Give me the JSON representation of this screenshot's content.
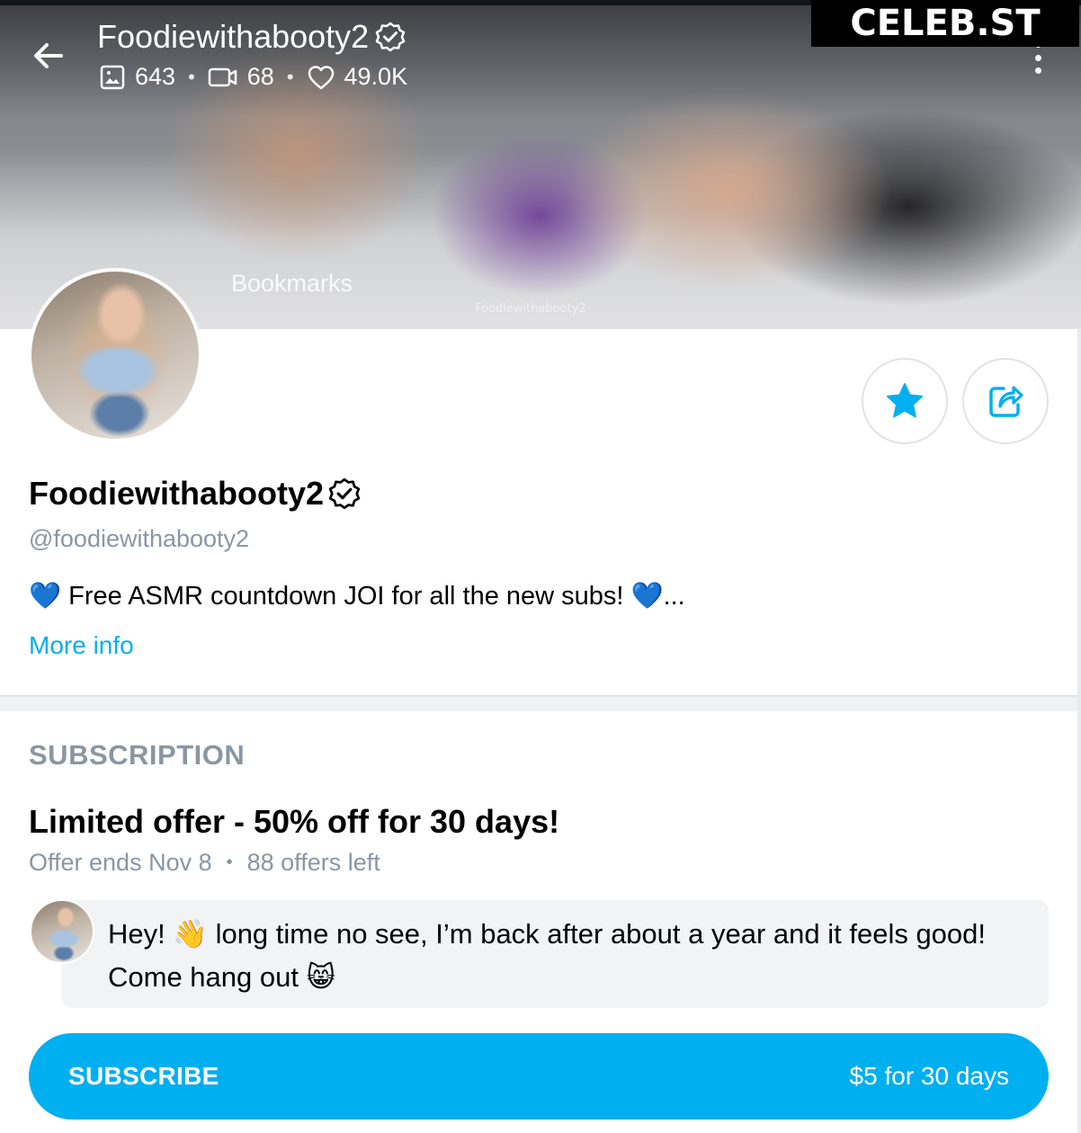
{
  "header": {
    "title": "Foodiewithabooty2",
    "stats": {
      "photos": "643",
      "videos": "68",
      "likes": "49.0K"
    },
    "bookmarks_label": "Bookmarks",
    "watermark": "Foodiewithabooty2"
  },
  "site_badge": "CELEB.ST",
  "profile": {
    "name": "Foodiewithabooty2",
    "handle": "@foodiewithabooty2",
    "bio_text": "Free ASMR countdown JOI for all the new subs!",
    "bio_prefix_emoji": "💙",
    "bio_suffix_emoji": "💙",
    "bio_ellipsis": "...",
    "more_info": "More info"
  },
  "subscription": {
    "heading": "SUBSCRIPTION",
    "offer_title": "Limited offer - 50% off for 30 days!",
    "offer_ends": "Offer ends Nov 8",
    "offers_left": "88 offers left",
    "message_line1": "Hey! 👋 long time no see, I’m back after about a year and it feels good!",
    "message_line2": "Come hang out 😸",
    "button_label": "SUBSCRIBE",
    "button_price": "$5 for 30 days"
  },
  "colors": {
    "accent": "#00aff0",
    "muted_text": "#8a96a3",
    "bubble_bg": "#f2f3f5"
  },
  "icons": {
    "back": "arrow-left-icon",
    "photos": "image-icon",
    "videos": "video-icon",
    "likes": "heart-icon",
    "verified": "verified-badge-icon",
    "menu": "more-vertical-icon",
    "favorite": "star-icon",
    "share": "share-icon"
  }
}
